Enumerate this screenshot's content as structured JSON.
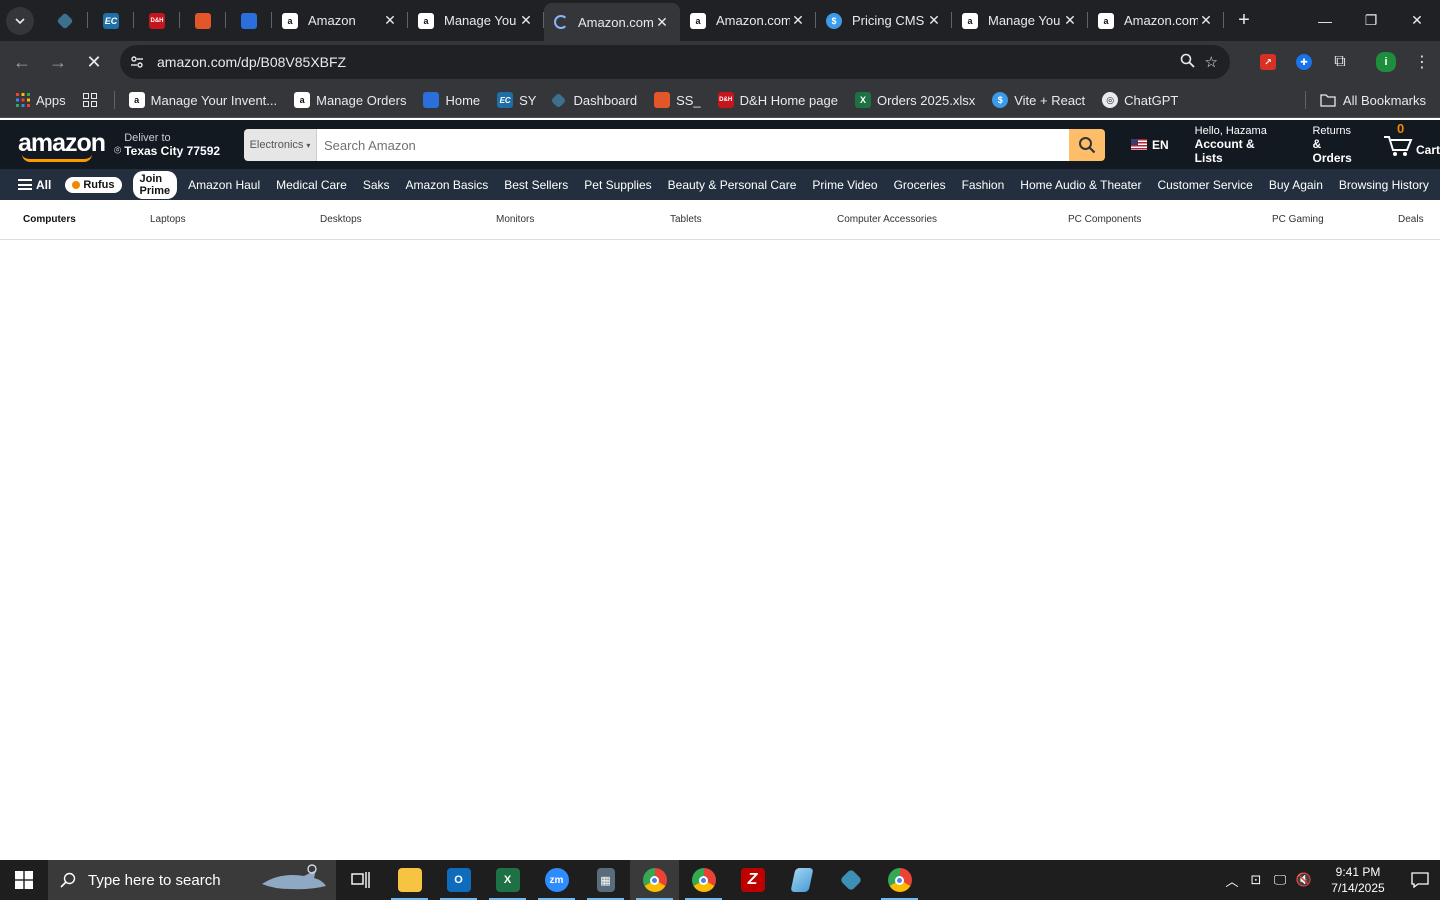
{
  "browser": {
    "tabs": [
      {
        "title": "Amazon",
        "favicon": "amazon-icon"
      },
      {
        "title": "Manage You",
        "favicon": "amazon-icon"
      },
      {
        "title": "Amazon.com",
        "favicon": "loading-icon",
        "active": true
      },
      {
        "title": "Amazon.com",
        "favicon": "amazon-icon"
      },
      {
        "title": "Pricing CMS",
        "favicon": "dollar-icon"
      },
      {
        "title": "Manage You",
        "favicon": "amazon-icon"
      },
      {
        "title": "Amazon.com",
        "favicon": "amazon-icon"
      }
    ],
    "pinned_tabs": [
      {
        "label": "",
        "color": "#3d6f8e"
      },
      {
        "label": "EC",
        "color": "#1d6fa5"
      },
      {
        "label": "D&H",
        "color": "#c4161c"
      },
      {
        "label": "",
        "color": "#e2572a"
      },
      {
        "label": "",
        "color": "#2a6fdb"
      }
    ],
    "url": "amazon.com/dp/B08V85XBFZ",
    "profile_initial": "i",
    "bookmarks": [
      {
        "label": "Apps",
        "icon": "apps-grid-icon"
      },
      {
        "label": "Manage Your Invent...",
        "icon": "amazon-icon"
      },
      {
        "label": "Manage Orders",
        "icon": "amazon-icon"
      },
      {
        "label": "Home",
        "icon": "home-site-icon"
      },
      {
        "label": "SY",
        "icon": "ec-icon"
      },
      {
        "label": "Dashboard",
        "icon": "dashboard-icon"
      },
      {
        "label": "SS_",
        "icon": "ss-icon"
      },
      {
        "label": "D&H Home page",
        "icon": "dh-icon"
      },
      {
        "label": "Orders 2025.xlsx",
        "icon": "excel-icon"
      },
      {
        "label": "Vite + React",
        "icon": "dollar-icon"
      },
      {
        "label": "ChatGPT",
        "icon": "chatgpt-icon"
      }
    ],
    "all_bookmarks_label": "All Bookmarks"
  },
  "amazon": {
    "logo": "amazon",
    "deliver_line1": "Deliver to",
    "deliver_line2": "Texas City 77592",
    "search_dept": "Electronics",
    "search_placeholder": "Search Amazon",
    "lang": "EN",
    "account_line1": "Hello, Hazama",
    "account_line2": "Account & Lists",
    "returns_line1": "Returns",
    "returns_line2": "& Orders",
    "cart_count": "0",
    "cart_label": "Cart",
    "nav_all": "All",
    "rufus": "Rufus",
    "join_prime": "Join Prime",
    "nav_links": [
      "Amazon Haul",
      "Medical Care",
      "Saks",
      "Amazon Basics",
      "Best Sellers",
      "Pet Supplies",
      "Beauty & Personal Care",
      "Prime Video",
      "Groceries",
      "Fashion",
      "Home Audio & Theater",
      "Customer Service",
      "Buy Again",
      "Browsing History"
    ],
    "subnav": [
      "Computers",
      "Laptops",
      "Desktops",
      "Monitors",
      "Tablets",
      "Computer Accessories",
      "PC Components",
      "PC Gaming",
      "Deals"
    ]
  },
  "taskbar": {
    "search_placeholder": "Type here to search",
    "time": "9:41 PM",
    "date": "7/14/2025",
    "apps": [
      {
        "name": "task-view-icon",
        "label": ""
      },
      {
        "name": "file-explorer-icon",
        "label": ""
      },
      {
        "name": "outlook-icon",
        "label": "O"
      },
      {
        "name": "excel-icon",
        "label": "X"
      },
      {
        "name": "zoom-icon",
        "label": "zm"
      },
      {
        "name": "calculator-icon",
        "label": ""
      },
      {
        "name": "chrome-icon",
        "label": ""
      },
      {
        "name": "chrome-profile-icon",
        "label": ""
      },
      {
        "name": "filezilla-icon",
        "label": "Z"
      },
      {
        "name": "notepad-icon",
        "label": ""
      },
      {
        "name": "dashboard-app-icon",
        "label": ""
      },
      {
        "name": "chrome-user-icon",
        "label": ""
      }
    ]
  },
  "colors": {
    "amazon_dark": "#131921",
    "amazon_nav": "#232f3e",
    "amazon_orange": "#ff9900",
    "search_button": "#febd69",
    "chrome_dark": "#202124",
    "chrome_toolbar": "#35363a"
  }
}
